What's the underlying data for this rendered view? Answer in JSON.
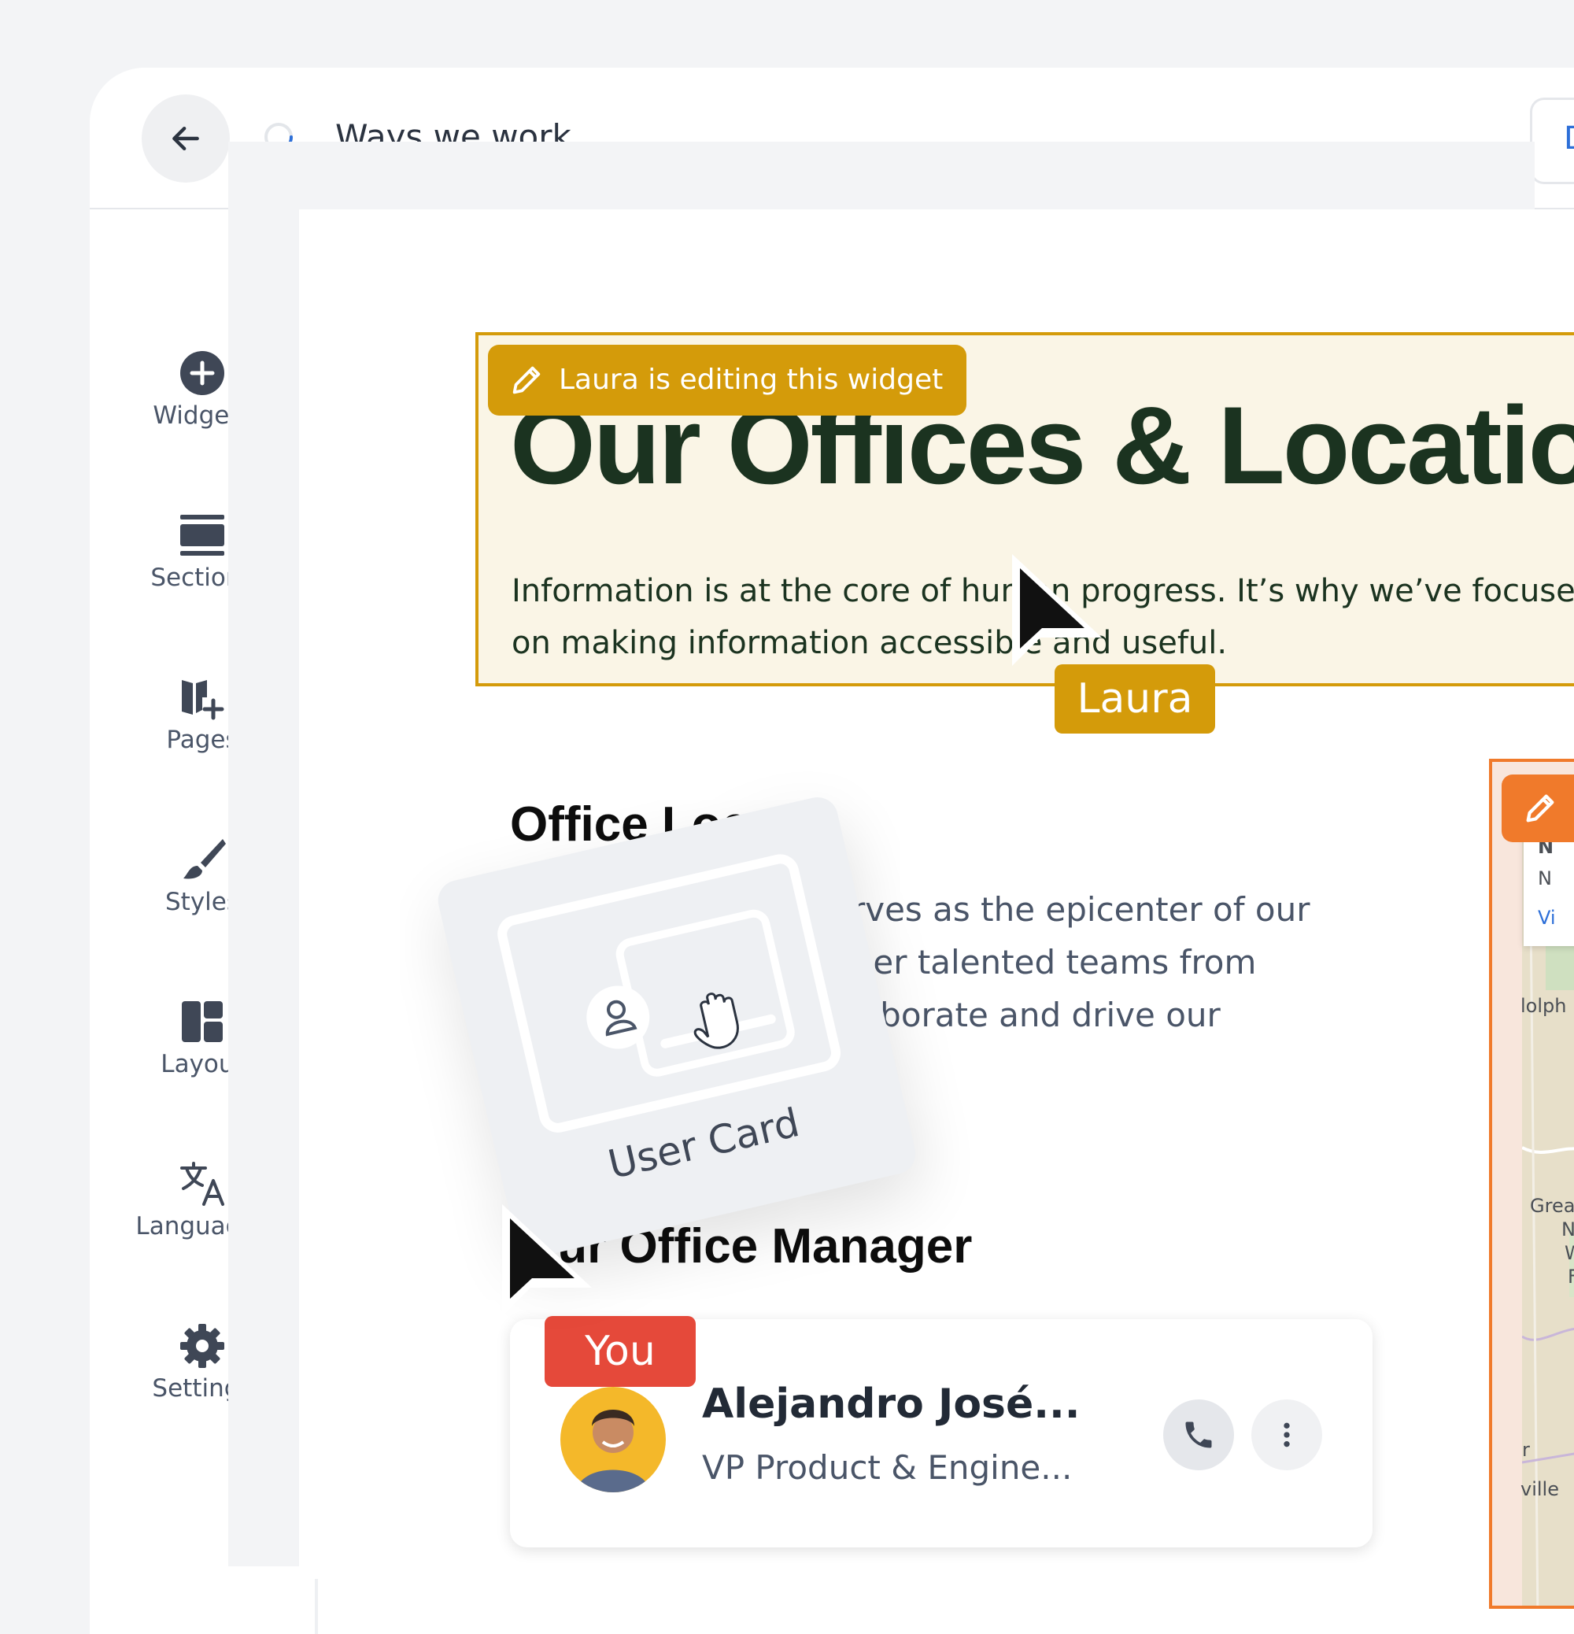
{
  "header": {
    "title": "Ways we work",
    "right_button_partial": "D"
  },
  "sidebar": {
    "items": [
      {
        "label": "Widgets",
        "icon": "plus-circle-icon"
      },
      {
        "label": "Sections",
        "icon": "sections-icon"
      },
      {
        "label": "Pages",
        "icon": "pages-icon"
      },
      {
        "label": "Styles",
        "icon": "brush-icon"
      },
      {
        "label": "Layout",
        "icon": "layout-icon"
      },
      {
        "label": "Languages",
        "icon": "translate-icon"
      },
      {
        "label": "Settings",
        "icon": "gear-icon"
      }
    ]
  },
  "hero": {
    "editing_badge": "Laura is editing this widget",
    "title": "Our Offices & Locations",
    "text": "Information is at the core of human progress. It’s why we’ve focused on making information accessible and useful."
  },
  "collaborators": {
    "laura": {
      "name": "Laura",
      "color": "#d49b0a"
    },
    "you": {
      "name": "You",
      "color": "#e5493a"
    }
  },
  "office": {
    "heading": "Office Locations",
    "text": "Our headquarters serves as the epicenter of our operations, where other talented teams from around the world collaborate and drive our"
  },
  "drag_widget": {
    "label": "User Card",
    "icon": "user-card-icon"
  },
  "manager": {
    "heading": "Our Office Manager",
    "name": "Alejandro José...",
    "role": "VP Product & Engine..."
  },
  "map": {
    "labels": [
      "N",
      "N",
      "Vi",
      "lolph",
      "Grea",
      "N",
      "W",
      "F",
      "r",
      "ville"
    ]
  },
  "colors": {
    "accent_laura": "#d49b0a",
    "accent_you": "#e5493a",
    "map_border": "#f07a2b",
    "hero_bg": "#faf5e6",
    "hero_text": "#1b3320"
  }
}
